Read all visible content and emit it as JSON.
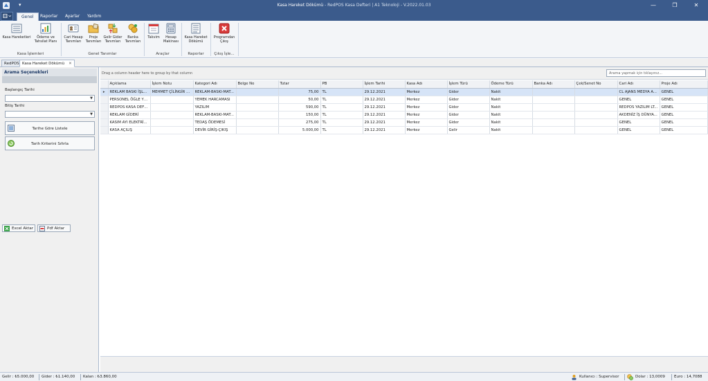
{
  "window": {
    "title_main": "Kasa Hareket Dökümü",
    "title_sub": " - RedPOS Kasa Defteri  |  A1 Teknoloji  - V.2022.01.03",
    "minimize": "—",
    "restore": "❐",
    "close": "✕"
  },
  "ribbon_tabs": [
    "Genel",
    "Raporlar",
    "Ayarlar",
    "Yardım"
  ],
  "ribbon": {
    "buttons": {
      "kasa_hareketleri": "Kasa Hareketleri",
      "odeme_tahsilat": "Ödeme ve Tahsilat Planı",
      "cari_hesap": "Cari Hesap Tanımları",
      "proje": "Proje Tanımları",
      "gelir_gider": "Gelir Gider Tanımları",
      "banka": "Banka Tanımları",
      "takvim": "Takvim",
      "hesap_makinasi": "Hesap Makinası",
      "kasa_hareket_dokumu": "Kasa Hareket Dökümü",
      "programdan_cikis": "Programdan Çıkış"
    },
    "groups": {
      "kasa_islemleri": "Kasa İşlemleri",
      "genel_tanimlar": "Genel Tanımlar",
      "araclar": "Araçlar",
      "raporlar": "Raporlar",
      "cikis": "Çıkış İşle..."
    }
  },
  "doc_tabs": {
    "home": "RedPOS",
    "active": "Kasa Hareket Dökümü",
    "close": "✕"
  },
  "left_panel": {
    "header": "Arama Seçenekleri",
    "start_date_label": "Başlangıç Tarihi",
    "end_date_label": "Bitiş Tarihi",
    "start_date_value": "",
    "end_date_value": "",
    "list_by_date": "Tarihe Göre Listele",
    "reset_date": "Tarih Kriterini Sıfırla",
    "excel_export": "Excel Aktar",
    "pdf_export": "Pdf Aktar"
  },
  "grid": {
    "group_hint": "Drag a column header here to group by that column",
    "search_placeholder": "Arama yapmak için tıklayınız...",
    "columns": [
      "Açıklama",
      "İşlem Notu",
      "Kategori Adı",
      "Belge No",
      "Tutar",
      "PB",
      "İşlem Tarihi",
      "Kasa Adı",
      "İşlem Türü",
      "Ödeme Türü",
      "Banka Adı",
      "Çek/Senet No",
      "Cari Adı",
      "Proje Adı"
    ],
    "rows": [
      [
        "REKLAM BASKI İŞLE...",
        "MEHMET ÇİLİNGİR K...",
        "REKLAM-BASKI-MAT...",
        "",
        "75,00",
        "TL",
        "29.12.2021",
        "Merkez",
        "Gider",
        "Nakit",
        "",
        "",
        "CL AJANS MEDYA A...",
        "GENEL"
      ],
      [
        "PERSONEL ÖĞLE YE...",
        "",
        "YEMEK HARCAMASI",
        "",
        "50,00",
        "TL",
        "29.12.2021",
        "Merkez",
        "Gider",
        "Nakit",
        "",
        "",
        "GENEL",
        "GENEL"
      ],
      [
        "REDPOS KASA DEFT...",
        "",
        "YAZILIM",
        "",
        "590,00",
        "TL",
        "29.12.2021",
        "Merkez",
        "Gider",
        "Nakit",
        "",
        "",
        "REDPOS YAZILIM LT...",
        "GENEL"
      ],
      [
        "REKLAM GİDERİ",
        "",
        "REKLAM-BASKI-MAT...",
        "",
        "150,00",
        "TL",
        "29.12.2021",
        "Merkez",
        "Gider",
        "Nakit",
        "",
        "",
        "AKDENİZ İŞ DÜNYA...",
        "GENEL"
      ],
      [
        "KASIM AYI ELEKTRİ...",
        "",
        "TEDAŞ ÖDEMESİ",
        "",
        "275,00",
        "TL",
        "29.12.2021",
        "Merkez",
        "Gider",
        "Nakit",
        "",
        "",
        "GENEL",
        "GENEL"
      ],
      [
        "KASA AÇILIŞ",
        "",
        "DEVİR GİRİŞ-ÇIKIŞ",
        "",
        "5.000,00",
        "TL",
        "29.12.2021",
        "Merkez",
        "Gelir",
        "Nakit",
        "",
        "",
        "GENEL",
        "GENEL"
      ]
    ],
    "selected_row": 0
  },
  "statusbar": {
    "gelir": "Gelir :  ₺5.000,00",
    "gider": "Gider :  ₺1.140,00",
    "kalan": "Kalan :  ₺3.860,00",
    "kullanici": "Kullanıcı :  Supervisor",
    "dolar": "Dolar :  13,0009",
    "euro": "Euro :  14,7088"
  },
  "colors": {
    "titlebar": "#3b5b8c",
    "selection": "#d6e4f7",
    "close_red": "#d83b3b"
  }
}
